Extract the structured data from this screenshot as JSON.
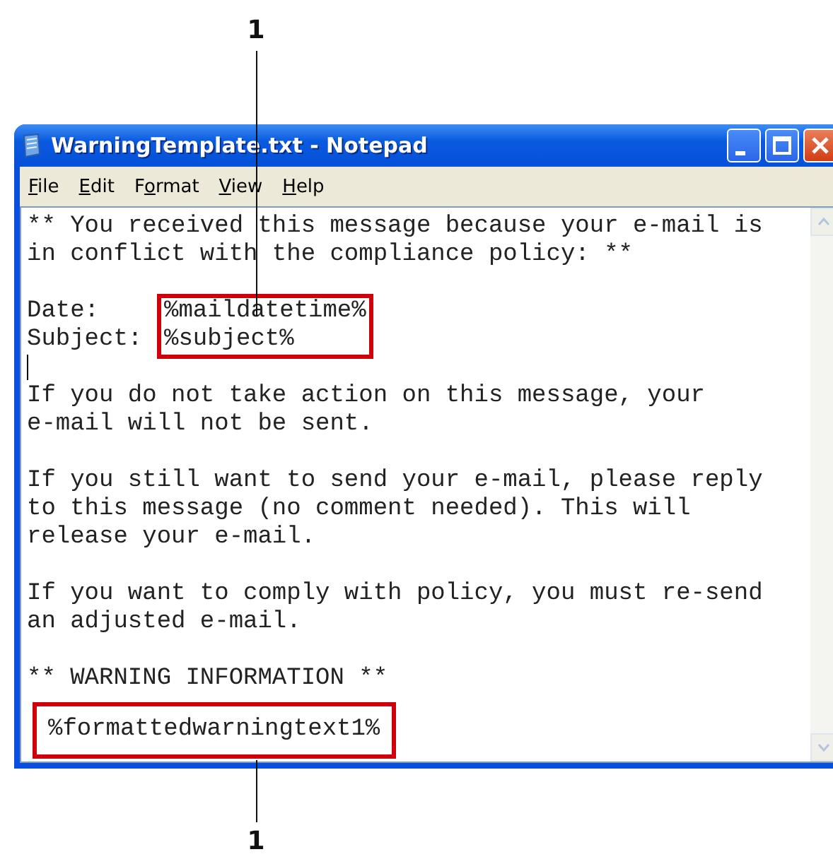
{
  "callouts": [
    {
      "label": "1"
    },
    {
      "label": "1"
    }
  ],
  "window": {
    "title": "WarningTemplate.txt - Notepad"
  },
  "menu": [
    {
      "accel": "F",
      "after": "ile"
    },
    {
      "accel": "E",
      "after": "dit"
    },
    {
      "before": "F",
      "accel": "o",
      "after": "rmat"
    },
    {
      "accel": "V",
      "after": "iew"
    },
    {
      "accel": "H",
      "after": "elp"
    }
  ],
  "document": {
    "lines": [
      {
        "kind": "text",
        "text": "** You received this message because your e-mail is"
      },
      {
        "kind": "text",
        "text": "in conflict with the compliance policy: **"
      },
      {
        "kind": "blank"
      },
      {
        "kind": "fields",
        "items": [
          {
            "label": "Date:",
            "value": "%maildatetime%"
          },
          {
            "label": "Subject:",
            "value": "%subject%"
          }
        ]
      },
      {
        "kind": "cursor"
      },
      {
        "kind": "text",
        "text": "If you do not take action on this message, your"
      },
      {
        "kind": "text",
        "text": "e-mail will not be sent."
      },
      {
        "kind": "blank"
      },
      {
        "kind": "text",
        "text": "If you still want to send your e-mail, please reply"
      },
      {
        "kind": "text",
        "text": "to this message (no comment needed). This will"
      },
      {
        "kind": "text",
        "text": "release your e-mail."
      },
      {
        "kind": "blank"
      },
      {
        "kind": "text",
        "text": "If you want to comply with policy, you must re-send"
      },
      {
        "kind": "text",
        "text": "an adjusted e-mail."
      },
      {
        "kind": "blank"
      },
      {
        "kind": "text",
        "text": "** WARNING INFORMATION **"
      },
      {
        "kind": "highlight",
        "text": "%formattedwarningtext1%"
      }
    ]
  }
}
